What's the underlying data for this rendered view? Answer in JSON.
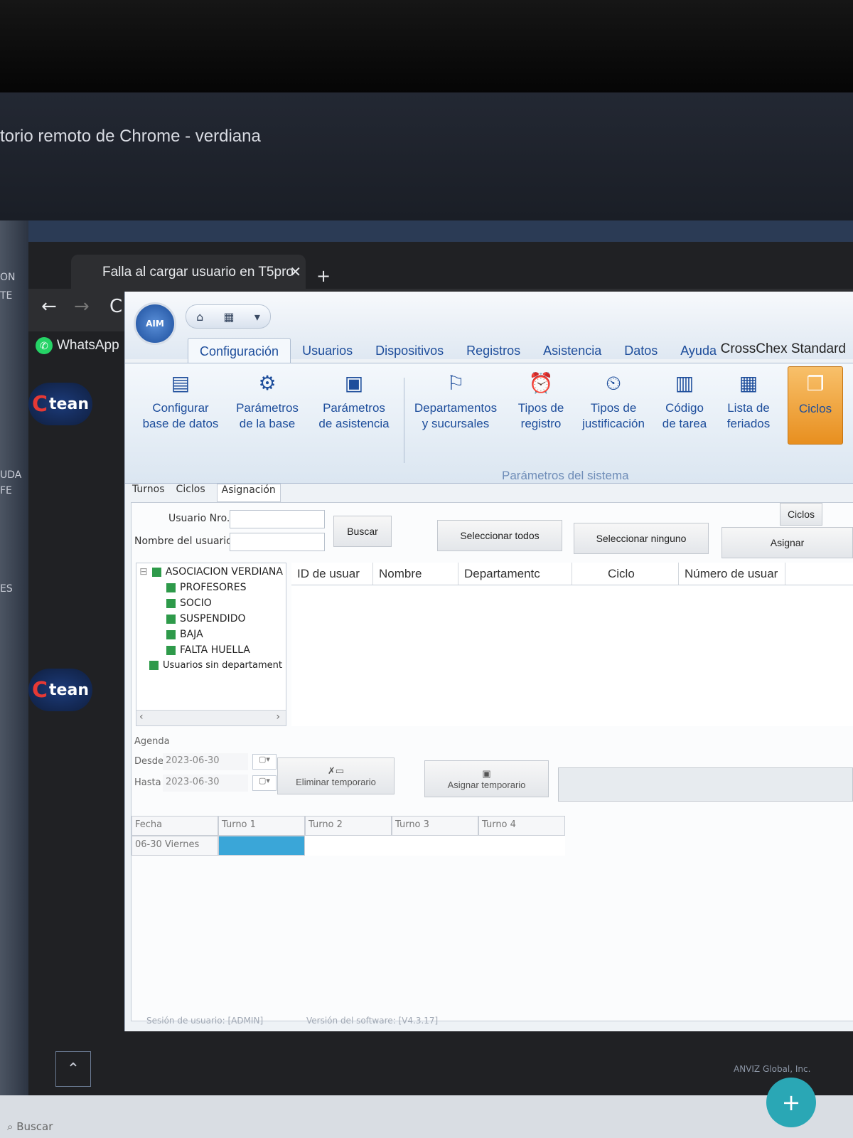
{
  "remote_window_title": "torio remoto de Chrome - verdiana",
  "desktop": {
    "frag1": "ON",
    "frag2": "TE",
    "frag3": "UDA",
    "frag4": "FE",
    "frag5": "ES"
  },
  "browser": {
    "tab_title": "Falla al cargar usuario en T5pro",
    "close_glyph": "✕",
    "new_tab_glyph": "+",
    "back_glyph": "←",
    "forward_glyph": "→",
    "reload_glyph": "C",
    "bookmark_label": "WhatsApp"
  },
  "team_logo_text": "tean",
  "app": {
    "logo_text": "AIM",
    "title": "CrossChex Standard",
    "menu": [
      "Configuración",
      "Usuarios",
      "Dispositivos",
      "Registros",
      "Asistencia",
      "Datos",
      "Ayuda"
    ],
    "ribbon": [
      {
        "line1": "Configurar",
        "line2": "base de datos"
      },
      {
        "line1": "Parámetros",
        "line2": "de la base"
      },
      {
        "line1": "Parámetros",
        "line2": "de asistencia"
      },
      {
        "line1": "Departamentos",
        "line2": "y sucursales"
      },
      {
        "line1": "Tipos de",
        "line2": "registro"
      },
      {
        "line1": "Tipos de",
        "line2": "justificación"
      },
      {
        "line1": "Código",
        "line2": "de tarea"
      },
      {
        "line1": "Lista de",
        "line2": "feriados"
      },
      {
        "line1": "Ciclos",
        "line2": ""
      }
    ],
    "group_label": "Parámetros del sistema",
    "subtabs": [
      "Turnos",
      "Ciclos",
      "Asignación"
    ],
    "ciclos_button": "Ciclos",
    "user_no_label": "Usuario Nro.",
    "user_name_label": "Nombre del usuario",
    "search_button": "Buscar",
    "select_all_button": "Seleccionar todos",
    "select_none_button": "Seleccionar ninguno",
    "assign_button": "Asignar",
    "tree": {
      "root": "ASOCIACION VERDIANA",
      "children": [
        "PROFESORES",
        "SOCIO",
        "SUSPENDIDO",
        "BAJA",
        "FALTA HUELLA"
      ],
      "no_dept": "Usuarios sin departament"
    },
    "grid_columns": [
      "ID de usuar",
      "Nombre",
      "Departamentc",
      "Ciclo",
      "Número de usuar"
    ],
    "agenda": {
      "label": "Agenda",
      "from_label": "Desde",
      "from_value": "2023-06-30",
      "to_label": "Hasta",
      "to_value": "2023-06-30",
      "delete_temp_button": "Eliminar temporario",
      "assign_temp_button": "Asignar temporario"
    },
    "schedule_columns": [
      "Fecha",
      "Turno 1",
      "Turno 2",
      "Turno 3",
      "Turno 4"
    ],
    "schedule_rows": [
      [
        "06-30 Viernes",
        "",
        "",
        "",
        ""
      ]
    ],
    "status": {
      "session": "Sesión de usuario: [ADMIN]",
      "version": "Versión del software: [V4.3.17]"
    }
  },
  "footer": {
    "anviz": "ANVIZ Global, Inc.",
    "fab_glyph": "+",
    "search": "Buscar"
  }
}
